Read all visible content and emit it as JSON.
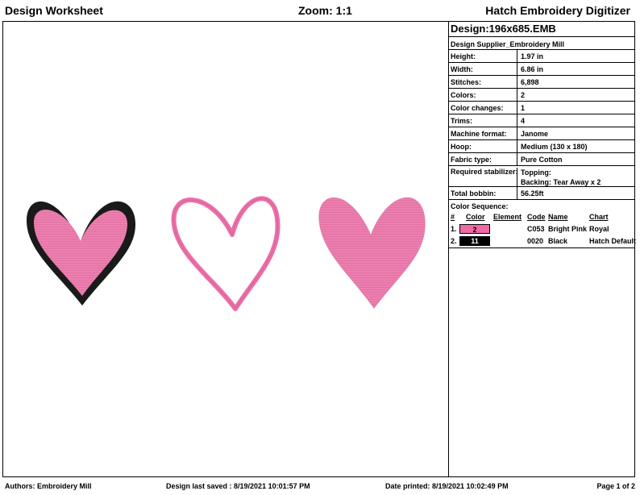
{
  "header": {
    "left": "Design Worksheet",
    "zoom": "Zoom:  1:1",
    "right": "Hatch Embroidery Digitizer"
  },
  "design": {
    "title": "Design:196x685.EMB",
    "supplier": "Design Supplier_Embroidery Mill",
    "props": [
      {
        "label": "Height:",
        "value": "1.97 in"
      },
      {
        "label": "Width:",
        "value": "6.86 in"
      },
      {
        "label": "Stitches:",
        "value": "6,898"
      },
      {
        "label": "Colors:",
        "value": "2"
      },
      {
        "label": "Color changes:",
        "value": "1"
      },
      {
        "label": "Trims:",
        "value": "4"
      },
      {
        "label": "Machine format:",
        "value": "Janome"
      },
      {
        "label": "Hoop:",
        "value": "Medium (130 x 180)"
      },
      {
        "label": "Fabric type:",
        "value": "Pure Cotton"
      }
    ],
    "stabilizer": {
      "label": "Required stabilizer:",
      "line1": "Topping:",
      "line2": "Backing: Tear Away x 2"
    },
    "bobbin": {
      "label": "Total bobbin:",
      "value": "56.25ft"
    }
  },
  "sequence": {
    "title": "Color Sequence:",
    "headers": {
      "num": "#",
      "color": "Color",
      "element": "Element",
      "code": "Code",
      "name": "Name",
      "chart": "Chart"
    },
    "rows": [
      {
        "num": "1.",
        "chip": "2",
        "chip_color": "#f06aa6",
        "chip_text_color": "#000000",
        "code": "C053",
        "name": "Bright Pink",
        "chart": "Royal"
      },
      {
        "num": "2.",
        "chip": "11",
        "chip_color": "#000000",
        "chip_text_color": "#ffffff",
        "code": "0020",
        "name": "Black",
        "chart": "Hatch Default"
      }
    ]
  },
  "colors": {
    "pink_fill": "#ec7fb0",
    "pink_outline": "#ec6fa8",
    "black": "#1a1a1a"
  },
  "footer": {
    "authors": "Authors: Embroidery Mill",
    "saved": "Design last saved : 8/19/2021 10:01:57 PM",
    "printed": "Date printed: 8/19/2021 10:02:49 PM",
    "page": "Page 1 of 2"
  }
}
